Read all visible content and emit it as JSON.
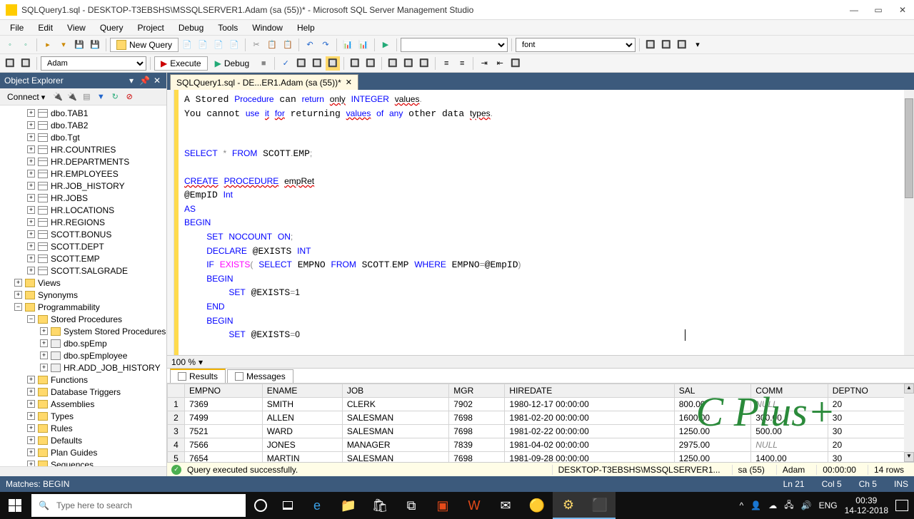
{
  "titlebar": {
    "title": "SQLQuery1.sql - DESKTOP-T3EBSHS\\MSSQLSERVER1.Adam (sa (55))* - Microsoft SQL Server Management Studio"
  },
  "menubar": [
    "File",
    "Edit",
    "View",
    "Query",
    "Project",
    "Debug",
    "Tools",
    "Window",
    "Help"
  ],
  "toolbar1": {
    "new_query": "New Query",
    "font_combo": "font"
  },
  "toolbar2": {
    "db_combo": "Adam",
    "execute": "Execute",
    "debug": "Debug"
  },
  "object_explorer": {
    "title": "Object Explorer",
    "connect": "Connect",
    "nodes": [
      {
        "pad": 38,
        "exp": "+",
        "icon": "table",
        "label": "dbo.TAB1"
      },
      {
        "pad": 38,
        "exp": "+",
        "icon": "table",
        "label": "dbo.TAB2"
      },
      {
        "pad": 38,
        "exp": "+",
        "icon": "table",
        "label": "dbo.Tgt"
      },
      {
        "pad": 38,
        "exp": "+",
        "icon": "table",
        "label": "HR.COUNTRIES"
      },
      {
        "pad": 38,
        "exp": "+",
        "icon": "table",
        "label": "HR.DEPARTMENTS"
      },
      {
        "pad": 38,
        "exp": "+",
        "icon": "table",
        "label": "HR.EMPLOYEES"
      },
      {
        "pad": 38,
        "exp": "+",
        "icon": "table",
        "label": "HR.JOB_HISTORY"
      },
      {
        "pad": 38,
        "exp": "+",
        "icon": "table",
        "label": "HR.JOBS"
      },
      {
        "pad": 38,
        "exp": "+",
        "icon": "table",
        "label": "HR.LOCATIONS"
      },
      {
        "pad": 38,
        "exp": "+",
        "icon": "table",
        "label": "HR.REGIONS"
      },
      {
        "pad": 38,
        "exp": "+",
        "icon": "table",
        "label": "SCOTT.BONUS"
      },
      {
        "pad": 38,
        "exp": "+",
        "icon": "table",
        "label": "SCOTT.DEPT"
      },
      {
        "pad": 38,
        "exp": "+",
        "icon": "table",
        "label": "SCOTT.EMP"
      },
      {
        "pad": 38,
        "exp": "+",
        "icon": "table",
        "label": "SCOTT.SALGRADE"
      },
      {
        "pad": 20,
        "exp": "+",
        "icon": "folder",
        "label": "Views"
      },
      {
        "pad": 20,
        "exp": "+",
        "icon": "folder",
        "label": "Synonyms"
      },
      {
        "pad": 20,
        "exp": "−",
        "icon": "folder",
        "label": "Programmability"
      },
      {
        "pad": 38,
        "exp": "−",
        "icon": "folder",
        "label": "Stored Procedures"
      },
      {
        "pad": 56,
        "exp": "+",
        "icon": "folder",
        "label": "System Stored Procedures"
      },
      {
        "pad": 56,
        "exp": "+",
        "icon": "sp",
        "label": "dbo.spEmp"
      },
      {
        "pad": 56,
        "exp": "+",
        "icon": "sp",
        "label": "dbo.spEmployee"
      },
      {
        "pad": 56,
        "exp": "+",
        "icon": "sp",
        "label": "HR.ADD_JOB_HISTORY"
      },
      {
        "pad": 38,
        "exp": "+",
        "icon": "folder",
        "label": "Functions"
      },
      {
        "pad": 38,
        "exp": "+",
        "icon": "folder",
        "label": "Database Triggers"
      },
      {
        "pad": 38,
        "exp": "+",
        "icon": "folder",
        "label": "Assemblies"
      },
      {
        "pad": 38,
        "exp": "+",
        "icon": "folder",
        "label": "Types"
      },
      {
        "pad": 38,
        "exp": "+",
        "icon": "folder",
        "label": "Rules"
      },
      {
        "pad": 38,
        "exp": "+",
        "icon": "folder",
        "label": "Defaults"
      },
      {
        "pad": 38,
        "exp": "+",
        "icon": "folder",
        "label": "Plan Guides"
      },
      {
        "pad": 38,
        "exp": "+",
        "icon": "folder",
        "label": "Sequences"
      }
    ]
  },
  "editor_tab": {
    "label": "SQLQuery1.sql - DE...ER1.Adam (sa (55))*"
  },
  "zoom": {
    "value": "100 %"
  },
  "result_tabs": {
    "results": "Results",
    "messages": "Messages"
  },
  "results": {
    "columns": [
      "",
      "EMPNO",
      "ENAME",
      "JOB",
      "MGR",
      "HIREDATE",
      "SAL",
      "COMM",
      "DEPTNO"
    ],
    "rows": [
      [
        "1",
        "7369",
        "SMITH",
        "CLERK",
        "7902",
        "1980-12-17 00:00:00",
        "800.00",
        "NULL",
        "20"
      ],
      [
        "2",
        "7499",
        "ALLEN",
        "SALESMAN",
        "7698",
        "1981-02-20 00:00:00",
        "1600.00",
        "300.00",
        "30"
      ],
      [
        "3",
        "7521",
        "WARD",
        "SALESMAN",
        "7698",
        "1981-02-22 00:00:00",
        "1250.00",
        "500.00",
        "30"
      ],
      [
        "4",
        "7566",
        "JONES",
        "MANAGER",
        "7839",
        "1981-04-02 00:00:00",
        "2975.00",
        "NULL",
        "20"
      ],
      [
        "5",
        "7654",
        "MARTIN",
        "SALESMAN",
        "7698",
        "1981-09-28 00:00:00",
        "1250.00",
        "1400.00",
        "30"
      ]
    ]
  },
  "status_exec": {
    "msg": "Query executed successfully.",
    "server": "DESKTOP-T3EBSHS\\MSSQLSERVER1...",
    "login": "sa (55)",
    "db": "Adam",
    "time": "00:00:00",
    "rows": "14 rows"
  },
  "status_editor": {
    "matches": "Matches: BEGIN",
    "ln": "Ln 21",
    "col": "Col 5",
    "ch": "Ch 5",
    "ins": "INS"
  },
  "watermark": "C Plus+",
  "taskbar": {
    "search_placeholder": "Type here to search",
    "lang": "ENG",
    "time": "00:39",
    "date": "14-12-2018"
  }
}
